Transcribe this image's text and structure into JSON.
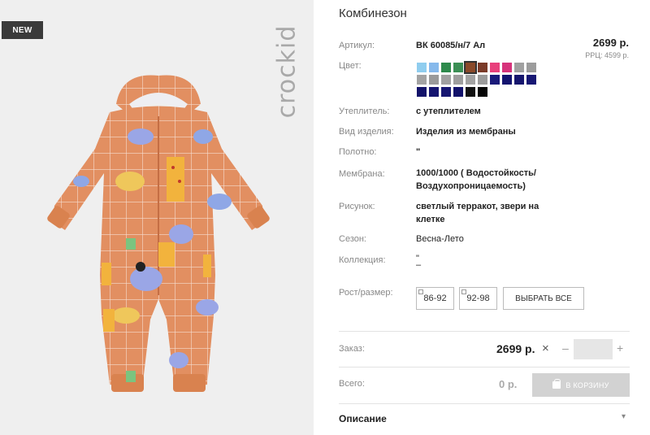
{
  "photo": {
    "badge": "NEW",
    "brand": "crockid",
    "image_alt": "Комбинезон"
  },
  "product": {
    "title": "Комбинезон",
    "price": "2699 р.",
    "rrp": "РРЦ: 4599 р."
  },
  "specs": {
    "article_label": "Артикул:",
    "article_value": "ВК 60085/н/7 Ал",
    "color_label": "Цвет:",
    "insulation_label": "Утеплитель:",
    "insulation_value": "с утеплителем",
    "type_label": "Вид изделия:",
    "type_value": "Изделия из мембраны",
    "fabric_label": "Полотно:",
    "fabric_value": "\"",
    "membrane_label": "Мембрана:",
    "membrane_value_line1": "1000/1000 ( Водостойкость/",
    "membrane_value_line2": "Воздухопроницаемость)",
    "pattern_label": "Рисунок:",
    "pattern_value_line1": "светлый терракот, звери на",
    "pattern_value_line2": "клетке",
    "season_label": "Сезон:",
    "season_value": "Весна-Лето",
    "collection_label": "Коллекция:",
    "collection_value_line1": "\"",
    "collection_value_line2": "–"
  },
  "colors": [
    {
      "hex": "#8fcdef"
    },
    {
      "hex": "#86b9ec"
    },
    {
      "hex": "#2e8a4c"
    },
    {
      "hex": "#3b8f55"
    },
    {
      "hex": "#8a4a2a",
      "selected": true
    },
    {
      "hex": "#7a3a28"
    },
    {
      "hex": "#e83f7b"
    },
    {
      "hex": "#d6337b"
    },
    {
      "hex": "#a0a0a0"
    },
    {
      "hex": "#9c9c9c"
    },
    {
      "hex": "#a3a3a3"
    },
    {
      "hex": "#9a9a9a"
    },
    {
      "hex": "#a1a1a1"
    },
    {
      "hex": "#9e9e9e"
    },
    {
      "hex": "#a2a2a2"
    },
    {
      "hex": "#9b9b9b"
    },
    {
      "hex": "#1a1a7a"
    },
    {
      "hex": "#141470"
    },
    {
      "hex": "#16166e"
    },
    {
      "hex": "#181874"
    },
    {
      "hex": "#13136a"
    },
    {
      "hex": "#151570"
    },
    {
      "hex": "#171772"
    },
    {
      "hex": "#12126b"
    },
    {
      "hex": "#111111"
    },
    {
      "hex": "#050505"
    }
  ],
  "sizes": {
    "label": "Рост/размер:",
    "options": [
      "86-92",
      "92-98"
    ],
    "select_all": "ВЫБРАТЬ ВСЕ"
  },
  "order": {
    "label": "Заказ:",
    "price": "2699 р.",
    "times": "×",
    "minus": "–",
    "plus": "+",
    "quantity": ""
  },
  "total": {
    "label": "Всего:",
    "value": "0 р.",
    "cart_button": "В КОРЗИНУ"
  },
  "description": {
    "label": "Описание",
    "arrow": "▾"
  }
}
